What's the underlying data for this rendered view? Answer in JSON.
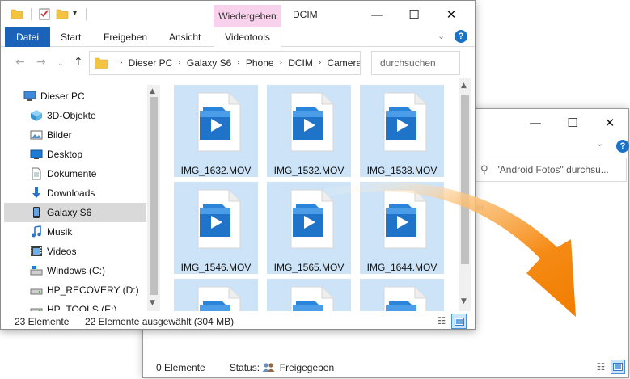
{
  "back_window": {
    "controls": {
      "minimize": "—",
      "maximize": "☐",
      "close": "✕"
    },
    "ribbon_chevron": "⌄",
    "help": "?",
    "search": {
      "icon": "search-icon",
      "placeholder": "\"Android Fotos\" durchsu..."
    },
    "empty_text": "st leer.",
    "status": {
      "count": "0 Elemente",
      "status_label": "Status:",
      "status_value": "Freigegeben"
    }
  },
  "front_window": {
    "title": "DCIM",
    "context_tab": "Wiedergeben",
    "controls": {
      "minimize": "—",
      "maximize": "☐",
      "close": "✕"
    },
    "quick_access": {
      "dropdown": "▾"
    },
    "ribbon": {
      "tabs": [
        "Datei",
        "Start",
        "Freigeben",
        "Ansicht",
        "Videotools"
      ],
      "chevron": "⌄",
      "help": "?"
    },
    "nav": {
      "back": "←",
      "forward": "→",
      "recent": "⌄",
      "up": "↑"
    },
    "breadcrumb": [
      "Dieser PC",
      "Galaxy S6",
      "Phone",
      "DCIM",
      "Camera"
    ],
    "breadcrumb_separator": "›",
    "search_placeholder": "durchsuchen",
    "tree": [
      {
        "label": "Dieser PC",
        "icon": "computer-icon",
        "selected": false
      },
      {
        "label": "3D-Objekte",
        "icon": "3d-objects-icon",
        "selected": false
      },
      {
        "label": "Bilder",
        "icon": "pictures-icon",
        "selected": false
      },
      {
        "label": "Desktop",
        "icon": "desktop-icon",
        "selected": false
      },
      {
        "label": "Dokumente",
        "icon": "documents-icon",
        "selected": false
      },
      {
        "label": "Downloads",
        "icon": "downloads-icon",
        "selected": false
      },
      {
        "label": "Galaxy S6",
        "icon": "phone-icon",
        "selected": true
      },
      {
        "label": "Musik",
        "icon": "music-icon",
        "selected": false
      },
      {
        "label": "Videos",
        "icon": "videos-icon",
        "selected": false
      },
      {
        "label": "Windows (C:)",
        "icon": "drive-windows-icon",
        "selected": false
      },
      {
        "label": "HP_RECOVERY (D:)",
        "icon": "drive-icon",
        "selected": false
      },
      {
        "label": "HP_TOOLS (E:)",
        "icon": "drive-icon",
        "selected": false
      }
    ],
    "files": [
      "IMG_1632.MOV",
      "IMG_1532.MOV",
      "IMG_1538.MOV",
      "IMG_1546.MOV",
      "IMG_1565.MOV",
      "IMG_1644.MOV",
      "",
      "",
      ""
    ],
    "file_icon": "video-file-icon",
    "status": {
      "count": "23 Elemente",
      "selected": "22 Elemente ausgewählt (304 MB)"
    },
    "colors": {
      "accent": "#1a63b8",
      "selection": "#cde4f8",
      "context_tab": "#f8d2ec",
      "arrow": "#f07d00"
    }
  }
}
